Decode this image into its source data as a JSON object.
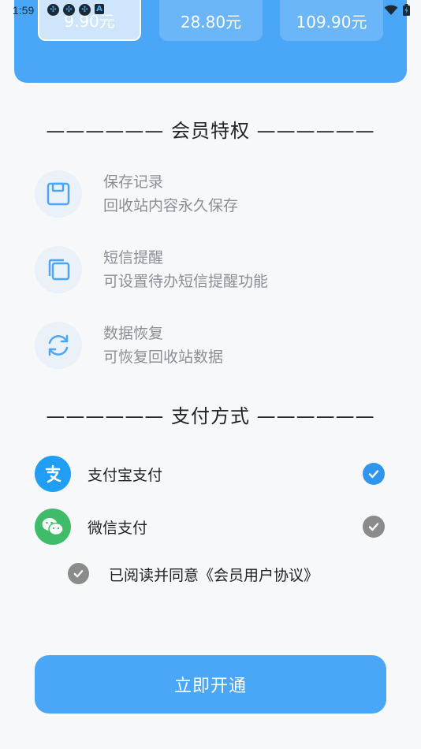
{
  "status_bar": {
    "time": "1:59",
    "notification_icons": [
      "notification-icon",
      "notification-icon",
      "notification-icon",
      "a-icon"
    ],
    "right_icons": [
      "wifi-icon",
      "battery-icon"
    ]
  },
  "plans": [
    {
      "price": "9.90元",
      "selected": true
    },
    {
      "price": "28.80元",
      "selected": false
    },
    {
      "price": "109.90元",
      "selected": false
    }
  ],
  "privileges": {
    "title": "—————— 会员特权 ——————",
    "items": [
      {
        "icon": "save-icon",
        "title": "保存记录",
        "desc": "回收站内容永久保存"
      },
      {
        "icon": "copy-icon",
        "title": "短信提醒",
        "desc": "可设置待办短信提醒功能"
      },
      {
        "icon": "sync-icon",
        "title": "数据恢复",
        "desc": "可恢复回收站数据"
      }
    ]
  },
  "payment": {
    "title": "—————— 支付方式 ——————",
    "methods": [
      {
        "icon": "alipay-icon",
        "label": "支付宝支付",
        "checked": true,
        "color": "#1f9ef3"
      },
      {
        "icon": "wechat-icon",
        "label": "微信支付",
        "checked": false,
        "color": "#3fbc6a"
      }
    ]
  },
  "agreement": {
    "text": "已阅读并同意《会员用户协议》",
    "checked": false
  },
  "submit": {
    "label": "立即开通"
  },
  "colors": {
    "primary": "#4aa7f8",
    "check_active": "#2f95ee",
    "check_inactive": "#8b8b8b"
  }
}
